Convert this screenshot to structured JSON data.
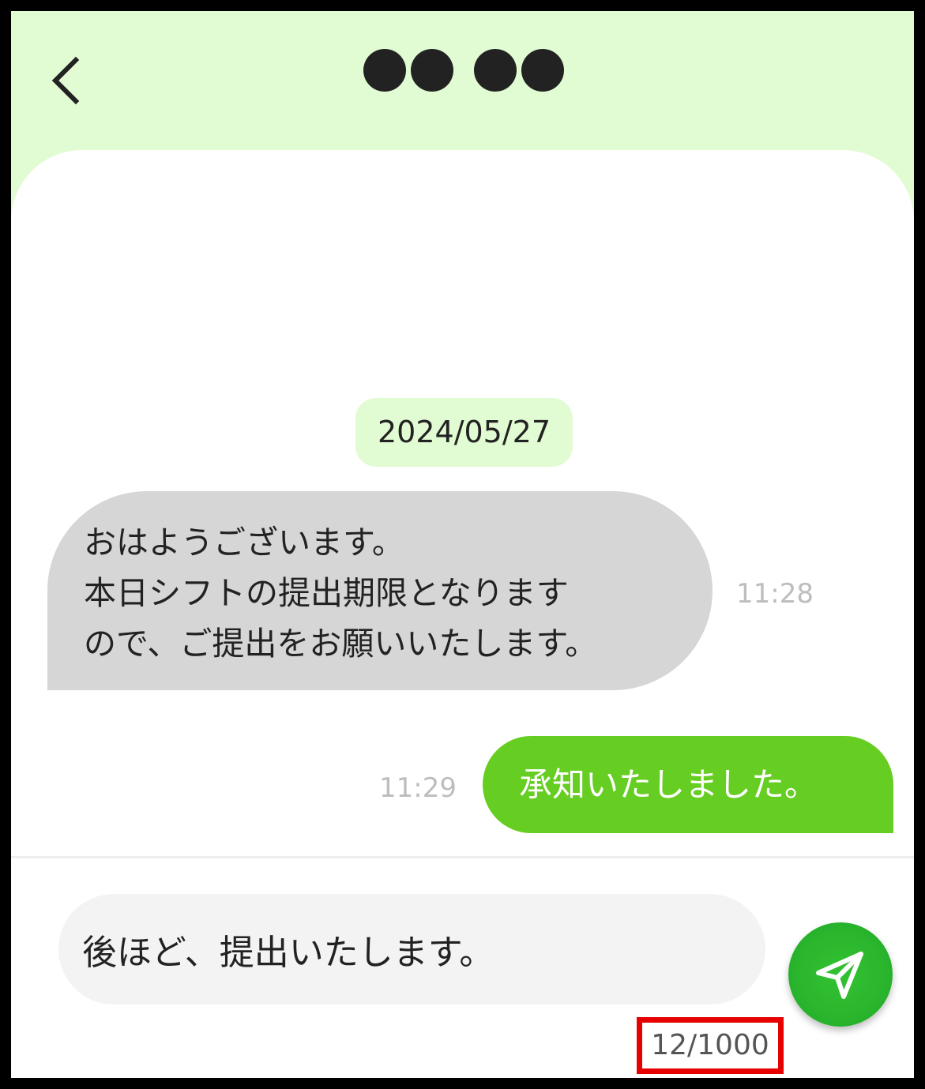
{
  "header": {
    "back_icon": "chevron-left-icon",
    "title_dots": [
      "●",
      "●",
      "●",
      "●"
    ],
    "background": "#e1fbd2"
  },
  "chat": {
    "date": "2024/05/27",
    "incoming": {
      "lines": [
        "おはようございます。",
        "本日シフトの提出期限となります",
        "ので、ご提出をお願いいたします。"
      ],
      "time": "11:28",
      "bubble_color": "#d6d6d6"
    },
    "outgoing": {
      "text": "承知いたしました。",
      "time": "11:29",
      "bubble_color": "#66cd22"
    }
  },
  "composer": {
    "value": "後ほど、提出いたします。",
    "char_count": "12/1000",
    "send_icon": "send-icon",
    "send_color": "#2ab52d",
    "highlight_color": "#e60000"
  }
}
